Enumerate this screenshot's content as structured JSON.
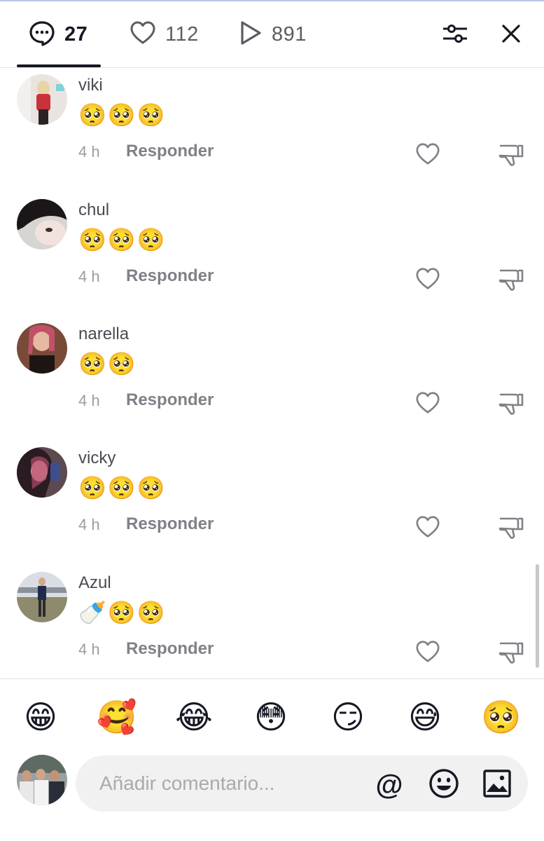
{
  "header": {
    "comments_count": "27",
    "likes_count": "112",
    "views_count": "891",
    "icons": [
      "comment-icon",
      "heart-icon",
      "play-icon",
      "filter-icon",
      "close-icon"
    ]
  },
  "comments": [
    {
      "username": "viki",
      "text": "🥺🥺🥺",
      "time": "4 h",
      "reply_label": "Responder"
    },
    {
      "username": "chul",
      "text": "🥺🥺🥺",
      "time": "4 h",
      "reply_label": "Responder"
    },
    {
      "username": "narella",
      "text": "🥺🥺",
      "time": "4 h",
      "reply_label": "Responder"
    },
    {
      "username": "vicky",
      "text": "🥺🥺🥺",
      "time": "4 h",
      "reply_label": "Responder"
    },
    {
      "username": "Azul",
      "text": "🍼🥺🥺",
      "time": "4 h",
      "reply_label": "Responder"
    }
  ],
  "quick_emojis": [
    "😁",
    "🥰",
    "😂",
    "😳",
    "😏",
    "😅",
    "🥺"
  ],
  "composer": {
    "placeholder": "Añadir comentario...",
    "mention_label": "@",
    "icons": [
      "mention-icon",
      "emoji-icon",
      "image-icon"
    ]
  },
  "colors": {
    "text_primary": "#161823",
    "text_secondary": "#808187",
    "input_bg": "#f1f1f2",
    "divider": "#e3e3e4"
  }
}
